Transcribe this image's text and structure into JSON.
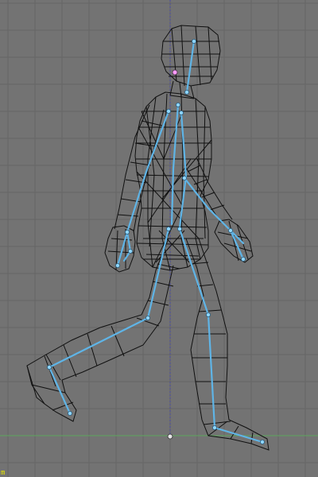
{
  "viewport": {
    "corner_label": "m",
    "colors": {
      "background": "#737373",
      "grid": "#666666",
      "ground_axis": "#5ea65e",
      "vertical_axis": "#4a4aa0",
      "wireframe": "#101010",
      "bones": "#5fb4e6",
      "bone_joints": "#8fd6ff",
      "selected_vertex": "#ff9cff",
      "origin": "#e6e6e6"
    }
  }
}
